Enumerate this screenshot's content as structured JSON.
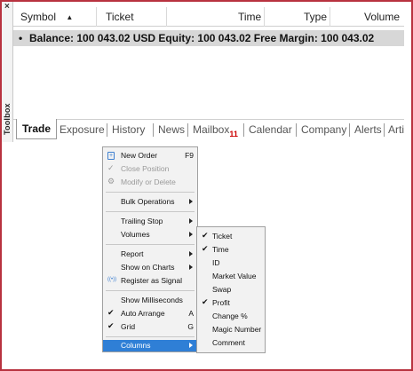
{
  "window": {
    "close_glyph": "×",
    "toolbox_label": "Toolbox"
  },
  "table": {
    "columns": [
      "Symbol",
      "Ticket",
      "Time",
      "Type",
      "Volume"
    ],
    "sort_glyph": "▲",
    "balance_row": {
      "bullet": "•",
      "text": "Balance: 100 043.02 USD  Equity: 100 043.02  Free Margin: 100 043.02"
    }
  },
  "tabs": {
    "items": [
      "Trade",
      "Exposure",
      "History",
      "News",
      "Mailbox",
      "Calendar",
      "Company",
      "Alerts",
      "Articles"
    ],
    "mailbox_count": "11",
    "active": "Trade"
  },
  "context_menu": {
    "new_order": {
      "label": "New Order",
      "shortcut": "F9"
    },
    "close_position": {
      "label": "Close Position"
    },
    "modify_delete": {
      "label": "Modify or Delete"
    },
    "bulk_operations": {
      "label": "Bulk Operations"
    },
    "trailing_stop": {
      "label": "Trailing Stop"
    },
    "volumes": {
      "label": "Volumes"
    },
    "report": {
      "label": "Report"
    },
    "show_on_charts": {
      "label": "Show on Charts"
    },
    "register_signal": {
      "label": "Register as Signal"
    },
    "show_milliseconds": {
      "label": "Show Milliseconds"
    },
    "auto_arrange": {
      "label": "Auto Arrange",
      "shortcut": "A",
      "checked": true
    },
    "grid": {
      "label": "Grid",
      "shortcut": "G",
      "checked": true
    },
    "columns": {
      "label": "Columns",
      "highlighted": true
    }
  },
  "columns_submenu": {
    "items": [
      {
        "label": "Ticket",
        "checked": true
      },
      {
        "label": "Time",
        "checked": true
      },
      {
        "label": "ID",
        "checked": false
      },
      {
        "label": "Market Value",
        "checked": false
      },
      {
        "label": "Swap",
        "checked": false
      },
      {
        "label": "Profit",
        "checked": true
      },
      {
        "label": "Change %",
        "checked": false
      },
      {
        "label": "Magic Number",
        "checked": false
      },
      {
        "label": "Comment",
        "checked": false
      }
    ]
  },
  "glyphs": {
    "check": "✔",
    "close_position_icon": "✓",
    "modify_icon": "⚙",
    "signal_icon": "((•))"
  },
  "colors": {
    "frame_border": "#b8323f",
    "highlight": "#2f7fd6",
    "mailbox_badge": "#cc0000",
    "balance_row_bg": "#d7d7d7"
  }
}
